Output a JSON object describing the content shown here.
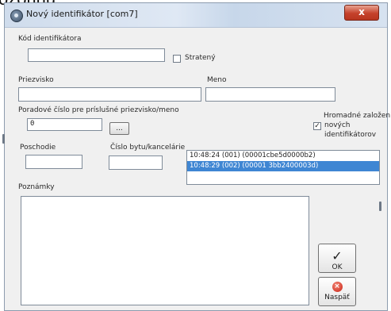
{
  "page": {
    "cut_text": "ozorinu."
  },
  "window": {
    "title": "Nový identifikátor [com7]",
    "close_label": "x"
  },
  "form": {
    "kod_label": "Kód identifikátora",
    "kod_value": "",
    "strateny_label": "Stratený",
    "strateny_checked": false,
    "priezvisko_label": "Priezvisko",
    "priezvisko_value": "",
    "meno_label": "Meno",
    "meno_value": "",
    "poradove_label": "Poradové číslo pre príslušné priezvisko/meno",
    "poradove_value": "0",
    "browse_label": "...",
    "hromadne_label_1": "Hromadné založenie",
    "hromadne_label_2": "nových",
    "hromadne_label_3": "identifikátorov",
    "hromadne_checked": true,
    "poschodie_label": "Poschodie",
    "poschodie_value": "",
    "cislo_label": "Číslo bytu/kancelárie",
    "cislo_value": "",
    "poznamky_label": "Poznámky",
    "poznamky_value": ""
  },
  "list": {
    "items": [
      "10:48:24 (001) (00001cbe5d0000b2)",
      "10:48:29 (002) (00001 3bb2400003d)"
    ],
    "selected_index": 1
  },
  "buttons": {
    "ok_label": "OK",
    "cancel_label": "Naspäť"
  }
}
